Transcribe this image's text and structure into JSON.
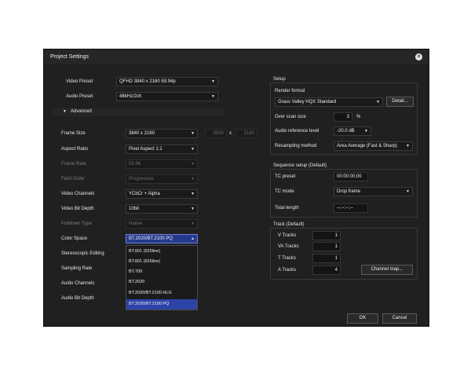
{
  "dialog": {
    "title": "Project Settings"
  },
  "left": {
    "video_preset": {
      "label": "Video Preset",
      "value": "QFHD 3840 x 2160 59.94p"
    },
    "audio_preset": {
      "label": "Audio Preset",
      "value": "48kHz/2ch"
    },
    "advanced": {
      "label": "Advanced"
    },
    "frame_size": {
      "label": "Frame Size",
      "value": "3840 x 2160",
      "width": "3840",
      "x": "x",
      "height": "2160"
    },
    "aspect_ratio": {
      "label": "Aspect Ratio",
      "value": "Pixel Aspect 1:1"
    },
    "frame_rate": {
      "label": "Frame Rate",
      "value": "59.94"
    },
    "field_order": {
      "label": "Field Order",
      "value": "Progressive"
    },
    "video_channels": {
      "label": "Video Channels",
      "value": "YCbCr + Alpha"
    },
    "video_bit_depth": {
      "label": "Video Bit Depth",
      "value": "10bit"
    },
    "pulldown_type": {
      "label": "Pulldown Type",
      "value": "Native"
    },
    "color_space": {
      "label": "Color Space",
      "value": "BT.2020/BT.2100 PQ"
    },
    "stereoscopic": {
      "label": "Stereoscopic Editing"
    },
    "sampling_rate": {
      "label": "Sampling Rate"
    },
    "audio_channels": {
      "label": "Audio Channels"
    },
    "audio_bit_depth": {
      "label": "Audio Bit Depth"
    }
  },
  "color_space_options": [
    "BT.601 (525line)",
    "BT.601 (625line)",
    "BT.709",
    "BT.2020",
    "BT.2020/BT.2100 HLG",
    "BT.2020/BT.2100 PQ"
  ],
  "setup": {
    "title": "Setup",
    "render_format": {
      "label": "Render format",
      "value": "Grass Valley HQX Standard",
      "detail_button": "Detail..."
    },
    "over_scan": {
      "label": "Over scan size",
      "value": "3",
      "unit": "%"
    },
    "audio_ref": {
      "label": "Audio reference level",
      "value": "-20.0 dB"
    },
    "resampling": {
      "label": "Resampling method",
      "value": "Area Average (Fast & Sharp)"
    }
  },
  "sequence": {
    "title": "Sequence setup (Default)",
    "tc_preset": {
      "label": "TC preset",
      "value": "00:00:00;00"
    },
    "tc_mode": {
      "label": "TC mode",
      "value": "Drop frame"
    },
    "total_length": {
      "label": "Total length",
      "value": "--:--:--;--"
    }
  },
  "track": {
    "title": "Track (Default)",
    "v": {
      "label": "V Tracks",
      "value": "1"
    },
    "va": {
      "label": "VA Tracks",
      "value": "1"
    },
    "t": {
      "label": "T Tracks",
      "value": "1"
    },
    "a": {
      "label": "A Tracks",
      "value": "4"
    },
    "channel_map": "Channel map..."
  },
  "footer": {
    "ok": "OK",
    "cancel": "Cancel"
  }
}
